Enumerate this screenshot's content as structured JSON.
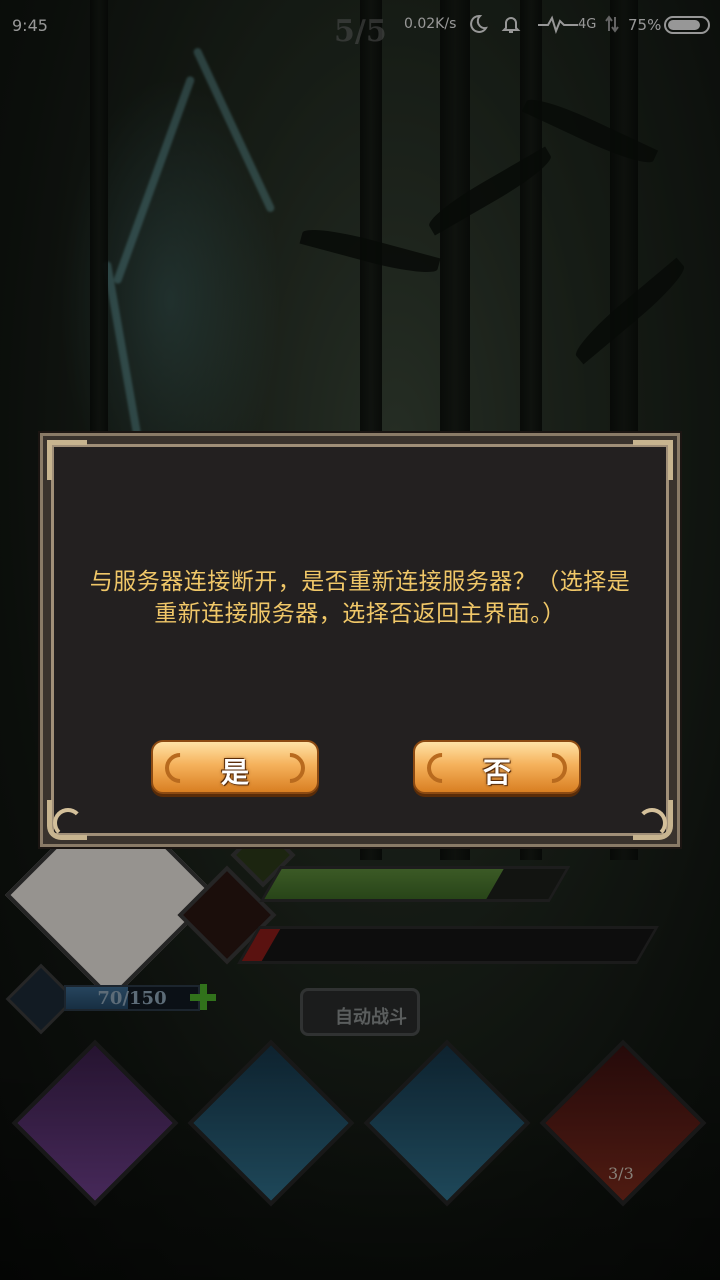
{
  "status_bar": {
    "time": "9:45",
    "net_speed": "0.02K/s",
    "network_type": "4G",
    "battery_percent": "75%",
    "battery_level": 0.75,
    "icons": [
      "moon-icon",
      "bell-icon",
      "signal-icon",
      "data-arrows-icon",
      "battery-icon"
    ]
  },
  "game": {
    "wave": "5/5",
    "energy": {
      "text": "70/150",
      "current": 70,
      "max": 150
    },
    "hp_fraction": 0.78,
    "rage_fraction": 0.05,
    "auto_battle_label": "自动战斗",
    "item_count": "3/3",
    "skills": [
      "lightning-skill",
      "water-vortex-skill",
      "water-vortex-skill",
      "ramen-item"
    ]
  },
  "dialog": {
    "message": "与服务器连接断开，是否重新连接服务器？（选择是重新连接服务器，选择否返回主界面。）",
    "yes_label": "是",
    "no_label": "否"
  },
  "colors": {
    "dialog_text": "#f0c768",
    "button_gold": "#f5b25c",
    "dialog_bg": "#232020",
    "hp_green": "#5b8a3a",
    "rage_red": "#8a1d1a"
  }
}
